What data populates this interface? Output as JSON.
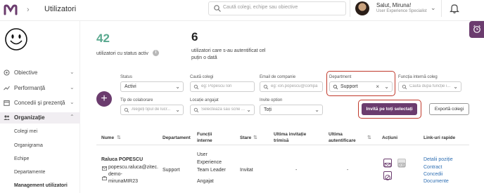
{
  "header": {
    "crumb": "Utilizatori",
    "search_placeholder": "Caută colegi, echipe sau obiective",
    "user_greeting": "Salut, Miruna!",
    "user_role": "User Experience Specialist"
  },
  "sidebar": {
    "items": [
      {
        "label": "Obiective"
      },
      {
        "label": "Performanță"
      },
      {
        "label": "Concedii și prezență"
      },
      {
        "label": "Organizație"
      }
    ],
    "sub_items": [
      {
        "label": "Colegi mei"
      },
      {
        "label": "Organigrama"
      },
      {
        "label": "Echipe"
      },
      {
        "label": "Departamente"
      },
      {
        "label": "Management utilizatori"
      }
    ]
  },
  "stats": {
    "active_count": "42",
    "active_label": "utilizatori cu status activ",
    "auth_count": "6",
    "auth_label_1": "utilizatori care s-au autentificat cel",
    "auth_label_2": "puțin o dată"
  },
  "filters": {
    "status_label": "Status",
    "status_value": "Activi",
    "colleague_label": "Caută colegi",
    "colleague_placeholder": "eg: Popescu Ion",
    "email_label": "Email de companie",
    "email_placeholder": "eg: ion.popescu@compa",
    "department_label": "Department",
    "department_value": "Support",
    "function_label": "Funcția internă coleg",
    "function_placeholder": "Caută după funcție i...",
    "collab_label": "Tip de colaborare",
    "collab_placeholder": "Alegeți tipul de lucr...",
    "location_label": "Locație angajat",
    "location_placeholder": "Selectează sau scrie ...",
    "invite_label": "Invite option",
    "invite_value": "Toți"
  },
  "buttons": {
    "invite_all": "Invită pe toți selectați",
    "export": "Exportă colegi",
    "add": "+"
  },
  "table": {
    "headers": {
      "name": "Nume",
      "department": "Departament",
      "function_1": "Funcții",
      "function_2": "interne",
      "status": "Stare",
      "last_invite_1": "Ultima invitație",
      "last_invite_2": "trimisă",
      "last_auth_1": "Ultima",
      "last_auth_2": "autentificare",
      "actions": "Acțiuni",
      "quick_links": "Link-uri rapide"
    },
    "row": {
      "name": "Raluca POPESCU",
      "email": "popescu.raluca@zitec.",
      "phone_1": "demo-",
      "phone_2": "mirunaMIR23",
      "department": "Support",
      "functions": [
        "User",
        "Experience",
        "Team Leader",
        "",
        "Angajat"
      ],
      "status": "Invitat",
      "last_invite": "-",
      "last_auth": "-",
      "links": [
        "Detalii poziție",
        "Contract",
        "Concedii",
        "Documente"
      ]
    }
  },
  "colors": {
    "brand": "#6b3c6e",
    "accent_green": "#5aa98f",
    "highlight_ring": "#c0392b",
    "link": "#2f6fb3"
  }
}
